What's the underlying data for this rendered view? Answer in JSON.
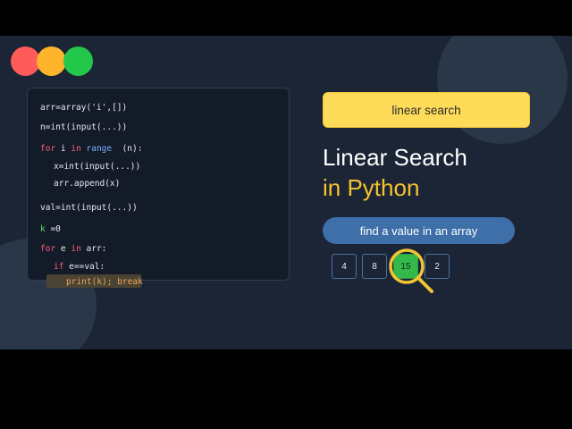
{
  "window": {
    "controls": [
      "close",
      "minimize",
      "maximize"
    ]
  },
  "code": {
    "line1": "arr=array('i',[])",
    "line2": "n=int(input(...))",
    "line3_kw": "for",
    "line3_var": " i ",
    "line3_in": "in",
    "line3_fn": " range ",
    "line3_rest": " (n):",
    "line4": "x=int(input(...))",
    "line5": "arr.append(x)",
    "line6": "val=int(input(...))",
    "line7_var": "k",
    "line7_rest": " =0",
    "line8_kw": "for",
    "line8_var": " e ",
    "line8_in": "in",
    "line8_rest": " arr:",
    "line9_kw": "if",
    "line9_rest": " e==val:",
    "line10": "print(k); break"
  },
  "hero": {
    "badge": "linear search",
    "title_line1": "Linear Search",
    "title_line2": "in Python",
    "subtitle_pill": "find a value in an array"
  },
  "array": {
    "cells": [
      "4",
      "8",
      "15",
      "2"
    ],
    "found_index": 2
  },
  "colors": {
    "accent_yellow": "#f6c230",
    "pill_blue": "#3e6fa8",
    "found_green": "#35b84a"
  }
}
